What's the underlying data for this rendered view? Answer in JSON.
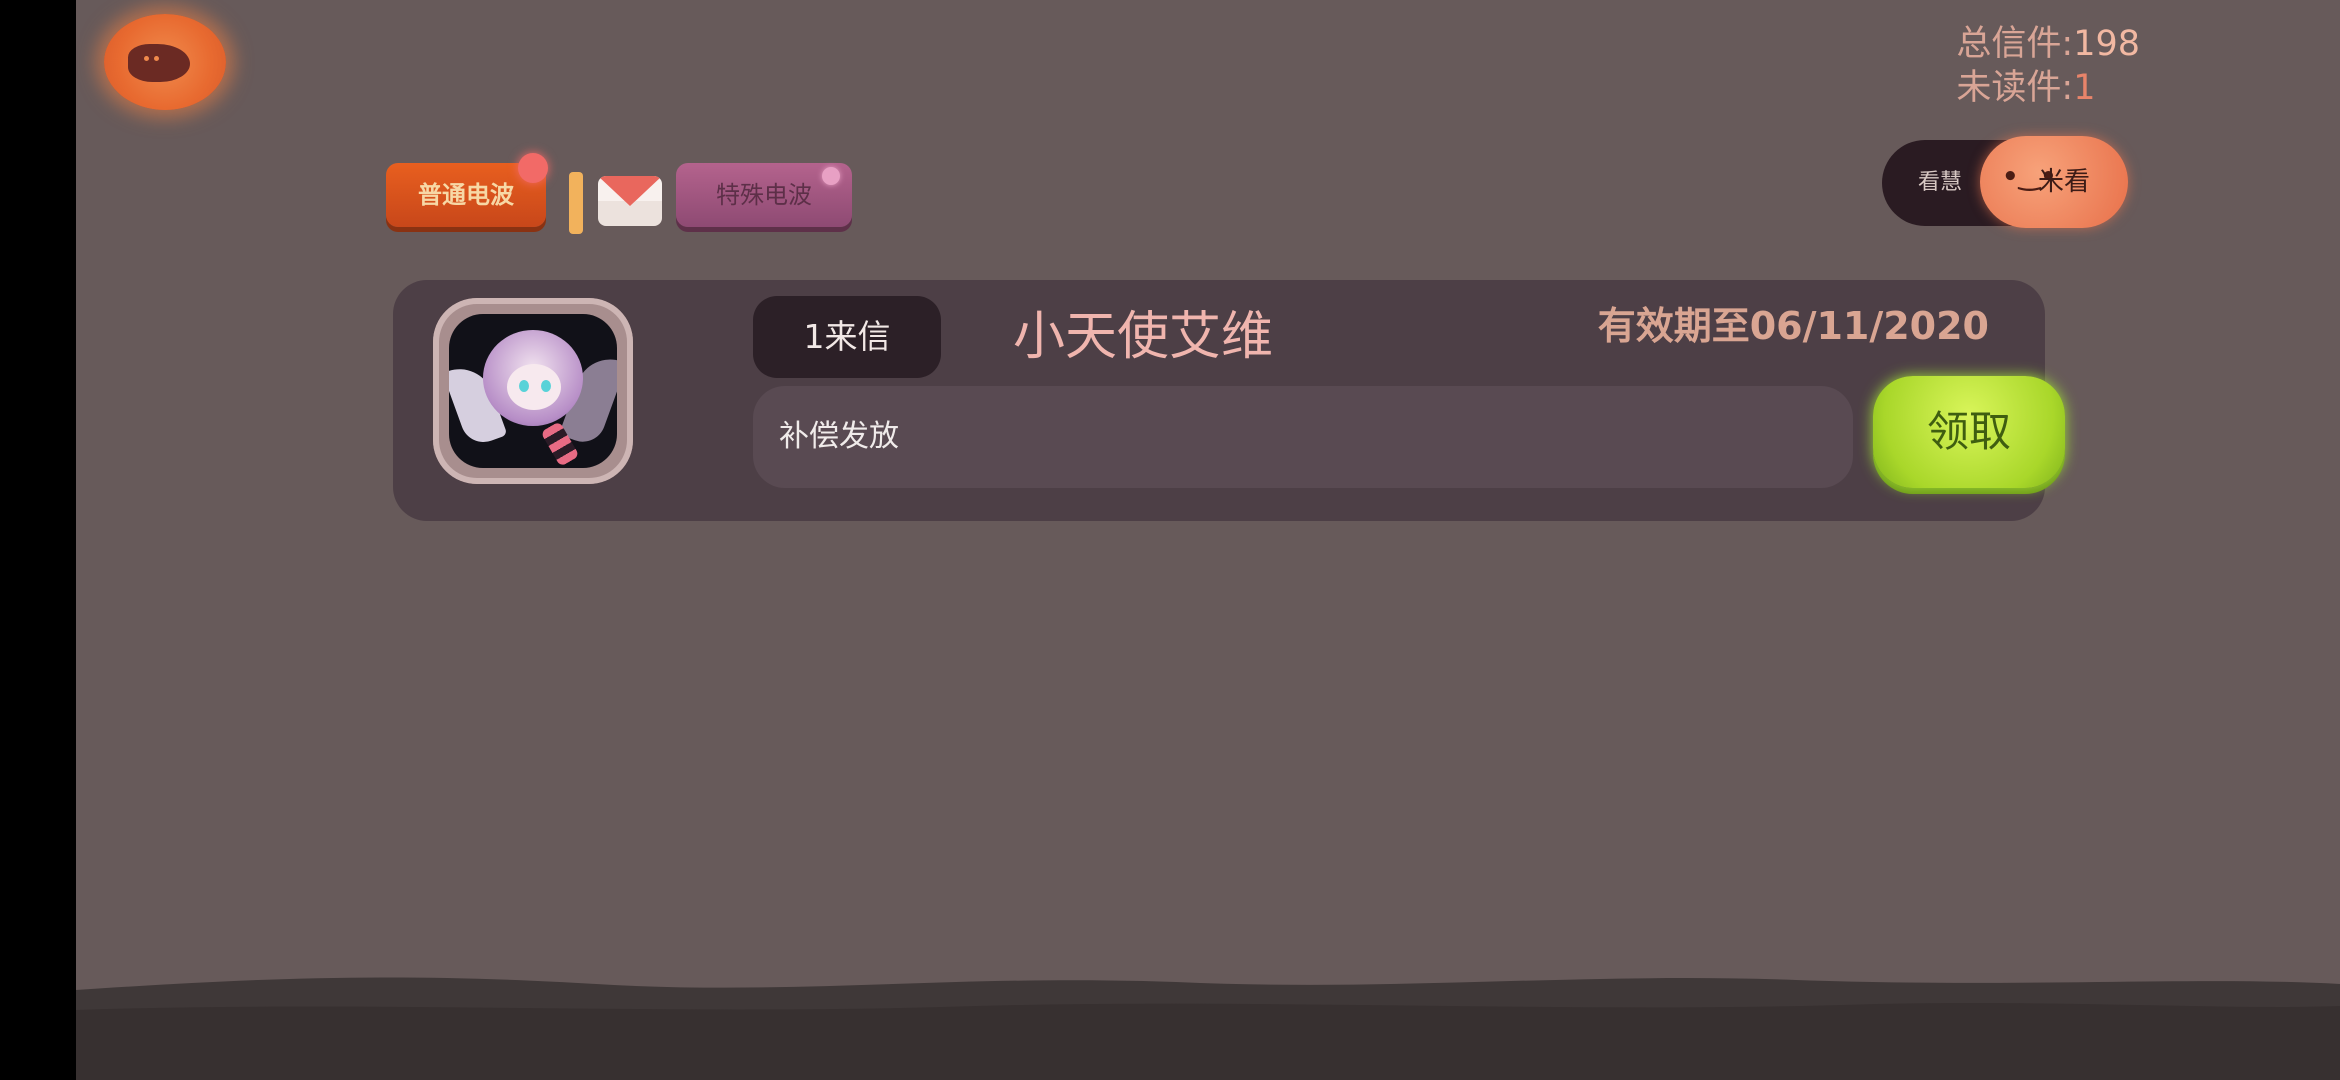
{
  "counters": {
    "total_label": "总信件:",
    "total_value": "198",
    "unread_label": "未读件:",
    "unread_value": "1"
  },
  "tabs": {
    "normal_label": "普通电波",
    "special_label": "特殊电波"
  },
  "toggle": {
    "off_label": "看慧",
    "on_label": "米看",
    "face": "•‿•"
  },
  "mail": {
    "count_badge": "1来信",
    "sender": "小天使艾维",
    "expiry": "有效期至06/11/2020",
    "subject": "补偿发放",
    "claim_label": "领取"
  },
  "colors": {
    "background": "#675a5a",
    "card": "#4d3f46",
    "normal_tab": "#e85f1f",
    "special_tab": "#b4638d",
    "claim_button": "#a9d72a"
  }
}
